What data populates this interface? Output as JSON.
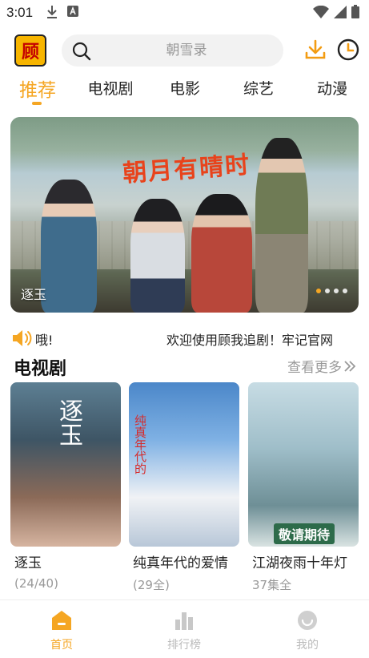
{
  "status_bar": {
    "time": "3:01"
  },
  "header": {
    "logo_text": "顾",
    "search_placeholder": "朝雪录"
  },
  "tabs": [
    {
      "label": "推荐",
      "active": true
    },
    {
      "label": "电视剧"
    },
    {
      "label": "电影"
    },
    {
      "label": "综艺"
    },
    {
      "label": "动漫"
    }
  ],
  "banner": {
    "art_title": "朝月有晴时",
    "caption": "逐玉",
    "dot_count": 4,
    "active_dot": 1
  },
  "notice": {
    "fragment": "哦!",
    "message": "欢迎使用顾我追剧！牢记官网"
  },
  "section": {
    "title": "电视剧",
    "see_more": "查看更多"
  },
  "cards": [
    {
      "title": "逐玉",
      "sub": "(24/40)",
      "poster_text": "逐玉"
    },
    {
      "title": "纯真年代的爱情",
      "sub": "(29全)",
      "poster_text": "纯真年代的"
    },
    {
      "title": "江湖夜雨十年灯",
      "sub": "37集全",
      "poster_text": "敬请期待"
    }
  ],
  "bottom_nav": [
    {
      "label": "首页",
      "icon": "home-icon",
      "active": true
    },
    {
      "label": "排行榜",
      "icon": "chart-icon"
    },
    {
      "label": "我的",
      "icon": "profile-icon"
    }
  ],
  "colors": {
    "accent": "#f5a623",
    "muted": "#999999"
  }
}
